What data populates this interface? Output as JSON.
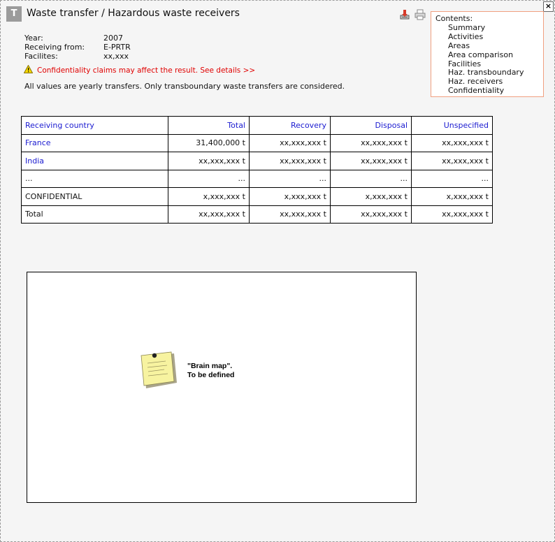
{
  "header": {
    "badge": "T",
    "title": "Waste transfer / Hazardous waste receivers",
    "close": "×"
  },
  "toolbar": {
    "export_icon": "download-icon",
    "print_icon": "print-icon"
  },
  "meta": {
    "year_label": "Year:",
    "year_value": "2007",
    "receiving_label": "Receiving from:",
    "receiving_value": "E-PRTR",
    "facilities_label": "Facilites:",
    "facilities_value": "xx,xxx"
  },
  "warning": {
    "icon": "warning-icon",
    "text": "Confidentiality claims may affect the result. See details >>"
  },
  "note": "All values are yearly transfers. Only transboundary waste transfers are considered.",
  "contents": {
    "heading": "Contents:",
    "items": [
      "Summary",
      "Activities",
      "Areas",
      "Area comparison",
      "Facilities",
      "Haz. transboundary",
      "Haz. receivers",
      "Confidentiality"
    ]
  },
  "table": {
    "headers": [
      "Receiving country",
      "Total",
      "Recovery",
      "Disposal",
      "Unspecified"
    ],
    "rows": [
      [
        "France",
        "31,400,000 t",
        "xx,xxx,xxx t",
        "xx,xxx,xxx t",
        "xx,xxx,xxx t"
      ],
      [
        "India",
        "xx,xxx,xxx t",
        "xx,xxx,xxx t",
        "xx,xxx,xxx t",
        "xx,xxx,xxx t"
      ],
      [
        "...",
        "...",
        "...",
        "...",
        "..."
      ],
      [
        "CONFIDENTIAL",
        "x,xxx,xxx t",
        "x,xxx,xxx t",
        "x,xxx,xxx t",
        "x,xxx,xxx t"
      ],
      [
        "Total",
        "xx,xxx,xxx t",
        "xx,xxx,xxx t",
        "xx,xxx,xxx t",
        "xx,xxx,xxx t"
      ]
    ],
    "linked_rows": [
      0,
      1
    ]
  },
  "map": {
    "line1": "\"Brain map\".",
    "line2": "To be defined",
    "sticky_icon": "sticky-note-icon",
    "colors": {
      "note": "#f7f3a0",
      "pin": "#222222"
    }
  },
  "colors": {
    "link": "#1a1ad0",
    "warning": "#e00000",
    "contents_border": "#f0a080"
  }
}
